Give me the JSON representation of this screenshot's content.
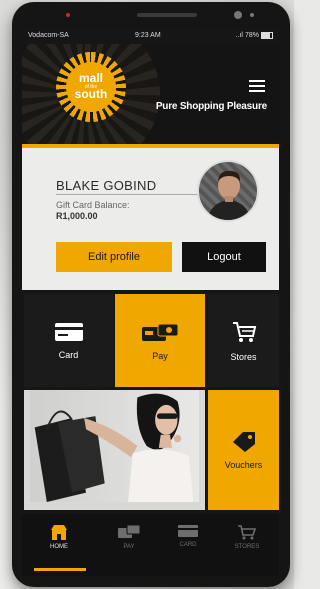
{
  "status_bar": {
    "carrier": "Vodacom-SA",
    "time": "9:23 AM",
    "signal": "..ıl",
    "battery": "78%"
  },
  "header": {
    "logo_line1": "mall",
    "logo_line2": "of the",
    "logo_line3": "south",
    "tagline": "Pure Shopping Pleasure"
  },
  "profile": {
    "name": "BLAKE GOBIND",
    "balance_label": "Gift Card Balance:",
    "balance_value": "R1,000.00",
    "edit_label": "Edit profile",
    "logout_label": "Logout"
  },
  "tiles": {
    "card": "Card",
    "pay": "Pay",
    "stores": "Stores",
    "vouchers": "Vouchers"
  },
  "nav": {
    "items": [
      {
        "label": "HOME",
        "icon": "store-icon",
        "active": true
      },
      {
        "label": "PAY",
        "icon": "pay-icon",
        "active": false
      },
      {
        "label": "CARD",
        "icon": "card-icon",
        "active": false
      },
      {
        "label": "STORES",
        "icon": "cart-icon",
        "active": false
      }
    ]
  },
  "colors": {
    "accent": "#f0a800",
    "dark": "#161616",
    "light": "#ececea"
  }
}
